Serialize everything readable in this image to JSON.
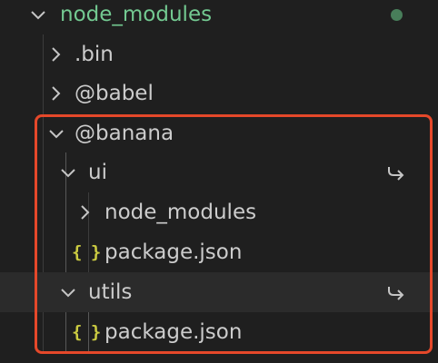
{
  "explorer": {
    "items": [
      {
        "label": "node_modules",
        "kind": "folder",
        "state": "expanded",
        "depth": 0
      },
      {
        "label": ".bin",
        "kind": "folder",
        "state": "collapsed",
        "depth": 1
      },
      {
        "label": "@babel",
        "kind": "folder",
        "state": "collapsed",
        "depth": 1
      },
      {
        "label": "@banana",
        "kind": "folder",
        "state": "expanded",
        "depth": 1
      },
      {
        "label": "ui",
        "kind": "folder",
        "state": "expanded",
        "depth": 2,
        "symlink": true
      },
      {
        "label": "node_modules",
        "kind": "folder",
        "state": "collapsed",
        "depth": 3
      },
      {
        "label": "package.json",
        "kind": "file",
        "icon": "{ }",
        "depth": 3
      },
      {
        "label": "utils",
        "kind": "folder",
        "state": "expanded",
        "depth": 2,
        "symlink": true,
        "selected": true
      },
      {
        "label": "package.json",
        "kind": "file",
        "icon": "{ }",
        "depth": 3
      }
    ]
  },
  "colors": {
    "background": "#1f1f1f",
    "root_label": "#73c991",
    "json_icon": "#cbcb41",
    "highlight_border": "#e5482a",
    "modified_dot": "#487e5a"
  },
  "icons": {
    "expanded": "chevron-down-icon",
    "collapsed": "chevron-right-icon",
    "symlink": "symlink-arrow-icon",
    "json": "json-braces-icon",
    "status": "status-dot-icon"
  }
}
